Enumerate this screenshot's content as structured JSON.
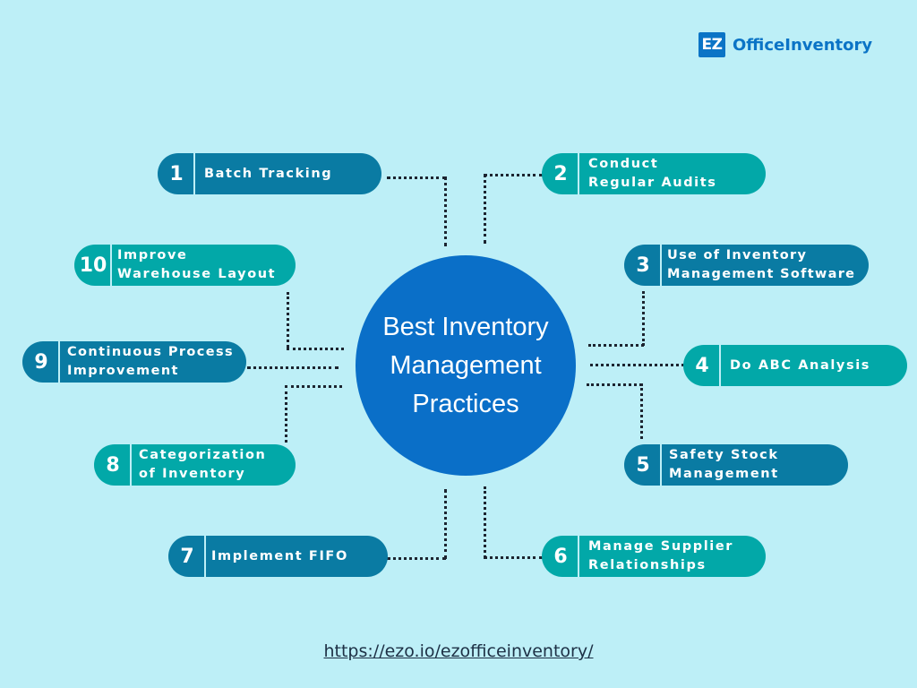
{
  "brand": {
    "badge": "EZ",
    "name": "OfficeInventory",
    "color": "#0b74c6"
  },
  "center": {
    "title": "Best Inventory Management Practices",
    "color": "#0a6fc8"
  },
  "colors": {
    "background": "#bdeff7",
    "dark_pill": "#0a7ba3",
    "teal_pill": "#02a8a8",
    "connector": "#1c2430"
  },
  "practices": [
    {
      "num": "1",
      "label": "Batch Tracking"
    },
    {
      "num": "2",
      "label": "Conduct\nRegular Audits"
    },
    {
      "num": "3",
      "label": "Use of Inventory\nManagement Software"
    },
    {
      "num": "4",
      "label": "Do ABC Analysis"
    },
    {
      "num": "5",
      "label": "Safety Stock\nManagement"
    },
    {
      "num": "6",
      "label": "Manage Supplier\nRelationships"
    },
    {
      "num": "7",
      "label": "Implement FIFO"
    },
    {
      "num": "8",
      "label": "Categorization\nof Inventory"
    },
    {
      "num": "9",
      "label": "Continuous Process\nImprovement"
    },
    {
      "num": "10",
      "label": "Improve\nWarehouse Layout"
    }
  ],
  "footer": {
    "url": "https://ezo.io/ezofficeinventory/"
  }
}
